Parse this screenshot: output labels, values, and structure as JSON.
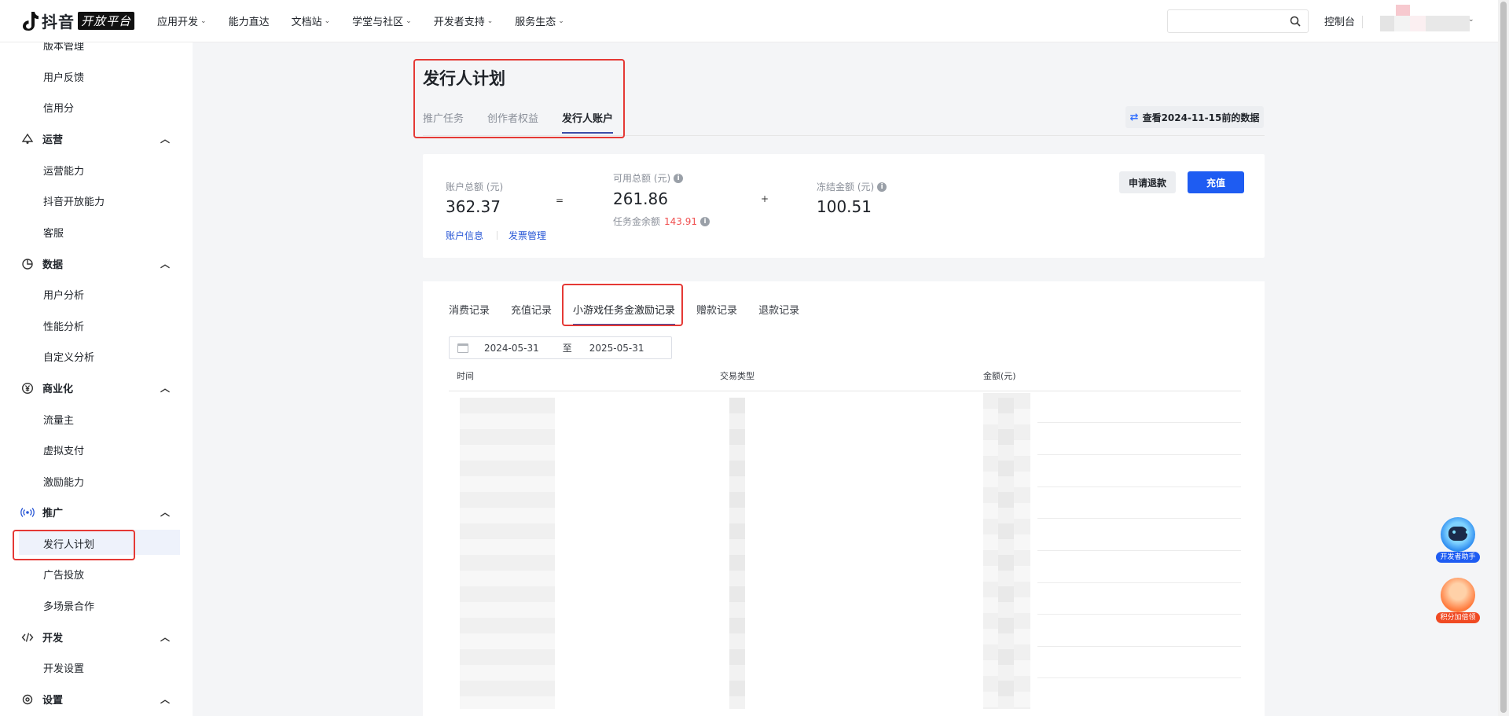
{
  "header": {
    "logo_text": "抖音",
    "logo_badge": "开放平台",
    "nav": [
      {
        "label": "应用开发",
        "has_menu": true
      },
      {
        "label": "能力直达",
        "has_menu": false
      },
      {
        "label": "文档站",
        "has_menu": true
      },
      {
        "label": "学堂与社区",
        "has_menu": true
      },
      {
        "label": "开发者支持",
        "has_menu": true
      },
      {
        "label": "服务生态",
        "has_menu": true
      }
    ],
    "search_placeholder": "",
    "console_label": "控制台"
  },
  "sidebar": {
    "top_items": [
      "版本管理",
      "用户反馈",
      "信用分"
    ],
    "groups": [
      {
        "label": "运营",
        "icon": "operation-icon",
        "items": [
          "运营能力",
          "抖音开放能力",
          "客服"
        ]
      },
      {
        "label": "数据",
        "icon": "pie-chart-icon",
        "items": [
          "用户分析",
          "性能分析",
          "自定义分析"
        ]
      },
      {
        "label": "商业化",
        "icon": "yuan-icon",
        "items": [
          "流量主",
          "虚拟支付",
          "激励能力"
        ]
      },
      {
        "label": "推广",
        "icon": "broadcast-icon",
        "items": [
          "发行人计划",
          "广告投放",
          "多场景合作"
        ]
      },
      {
        "label": "开发",
        "icon": "code-icon",
        "items": [
          "开发设置"
        ]
      },
      {
        "label": "设置",
        "icon": "settings-icon",
        "items": []
      }
    ],
    "active_item": "发行人计划"
  },
  "main": {
    "title": "发行人计划",
    "tabs": [
      "推广任务",
      "创作者权益",
      "发行人账户"
    ],
    "active_tab": "发行人账户",
    "history_button": "查看2024-11-15前的数据",
    "account": {
      "total_label": "账户总额 (元)",
      "total_value": "362.37",
      "eq": "=",
      "available_label": "可用总额 (元)",
      "available_value": "261.86",
      "task_balance_label": "任务金余额",
      "task_balance_value": "143.91",
      "plus": "+",
      "frozen_label": "冻结金额 (元)",
      "frozen_value": "100.51",
      "link_account": "账户信息",
      "link_invoice": "发票管理",
      "refund_button": "申请退款",
      "recharge_button": "充值"
    },
    "records": {
      "tabs": [
        "消费记录",
        "充值记录",
        "小游戏任务金激励记录",
        "赠款记录",
        "退款记录"
      ],
      "active_tab": "小游戏任务金激励记录",
      "date_start": "2024-05-31",
      "date_sep": "至",
      "date_end": "2025-05-31",
      "columns": [
        "时间",
        "交易类型",
        "金额(元)"
      ]
    }
  },
  "floating": {
    "assistant_label": "开发者助手",
    "points_label": "积分加倍领"
  },
  "colors": {
    "primary": "#1e5cf2",
    "highlight_box": "#e53935",
    "danger_text": "#f05050"
  }
}
